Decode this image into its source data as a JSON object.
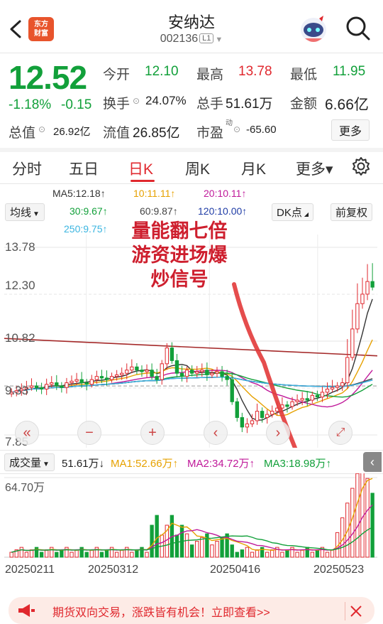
{
  "header": {
    "title": "安纳达",
    "code": "002136",
    "market_tag": "L1",
    "logo_line1": "东方",
    "logo_line2": "财富"
  },
  "quote": {
    "price": "12.52",
    "change_pct": "-1.18%",
    "change": "-0.15",
    "open_label": "今开",
    "open": "12.10",
    "high_label": "最高",
    "high": "13.78",
    "low_label": "最低",
    "low": "11.95",
    "turnover_label": "换手",
    "turnover": "24.07%",
    "volume_label": "总手",
    "volume": "51.61万",
    "amount_label": "金额",
    "amount": "6.66亿",
    "mktcap_label": "总值",
    "mktcap": "26.92亿",
    "float_label": "流值",
    "float_cap": "26.85亿",
    "pe_label": "市盈",
    "pe_sup": "动",
    "pe": "-65.60",
    "more_label": "更多"
  },
  "tabs": [
    {
      "label": "分时"
    },
    {
      "label": "五日"
    },
    {
      "label": "日K"
    },
    {
      "label": "周K"
    },
    {
      "label": "月K"
    },
    {
      "label": "更多▾"
    }
  ],
  "chart_header": {
    "indicator_select": "均线",
    "ma5": "MA5:12.18↑",
    "ma10": "10:11.11↑",
    "ma20": "20:10.11↑",
    "ma30": "30:9.67↑",
    "ma60": "60:9.87↑",
    "ma120": "120:10.00↑",
    "ma250": "250:9.75↑",
    "dk_label": "DK点",
    "adjust_label": "前复权"
  },
  "axis": {
    "y_top": "13.78",
    "y2": "12.30",
    "y3": "10.82",
    "y4": "9.33",
    "y_bottom": "7.85",
    "vol_top": "64.70万",
    "dates": [
      "20250211",
      "20250312",
      "20250416",
      "20250523"
    ]
  },
  "annotation": {
    "line1": "量能翻七倍",
    "line2": "游资进场爆",
    "line3": "炒信号"
  },
  "volume_header": {
    "select": "成交量",
    "total": "51.61万↓",
    "ma1": "MA1:52.66万↑",
    "ma2": "MA2:34.72万↑",
    "ma3": "MA3:18.98万↑"
  },
  "banner": {
    "text": "期货双向交易，涨跌皆有机会！立即查看>>"
  },
  "colors": {
    "up": "#e0282e",
    "down": "#12a03a",
    "annotation": "#ce1f2e"
  },
  "chart_data": {
    "type": "candlestick",
    "ylim": [
      7.85,
      13.78
    ],
    "x_ticks": [
      "20250211",
      "20250312",
      "20250416",
      "20250523"
    ],
    "ma_lines": [
      "MA5",
      "MA10",
      "MA20",
      "MA30",
      "MA60",
      "MA120",
      "MA250"
    ],
    "closes": [
      9.2,
      9.25,
      9.3,
      9.35,
      9.4,
      9.35,
      9.3,
      9.45,
      9.5,
      9.4,
      9.35,
      9.5,
      9.55,
      9.6,
      9.5,
      9.45,
      9.6,
      9.7,
      9.65,
      9.6,
      9.7,
      9.75,
      9.8,
      9.9,
      10.0,
      9.9,
      9.85,
      9.9,
      9.7,
      9.6,
      10.1,
      10.6,
      10.2,
      9.8,
      9.7,
      9.9,
      9.8,
      9.85,
      9.9,
      9.75,
      9.8,
      9.85,
      9.7,
      9.6,
      8.9,
      8.4,
      8.1,
      8.2,
      8.3,
      8.6,
      8.4,
      8.5,
      8.6,
      8.7,
      8.8,
      8.75,
      8.9,
      8.95,
      9.0,
      8.95,
      9.1,
      9.05,
      9.2,
      9.3,
      9.35,
      9.4,
      9.5,
      10.3,
      11.2,
      12.0,
      12.3,
      12.7,
      12.52
    ],
    "volume_ylim_top": "64.70万"
  }
}
